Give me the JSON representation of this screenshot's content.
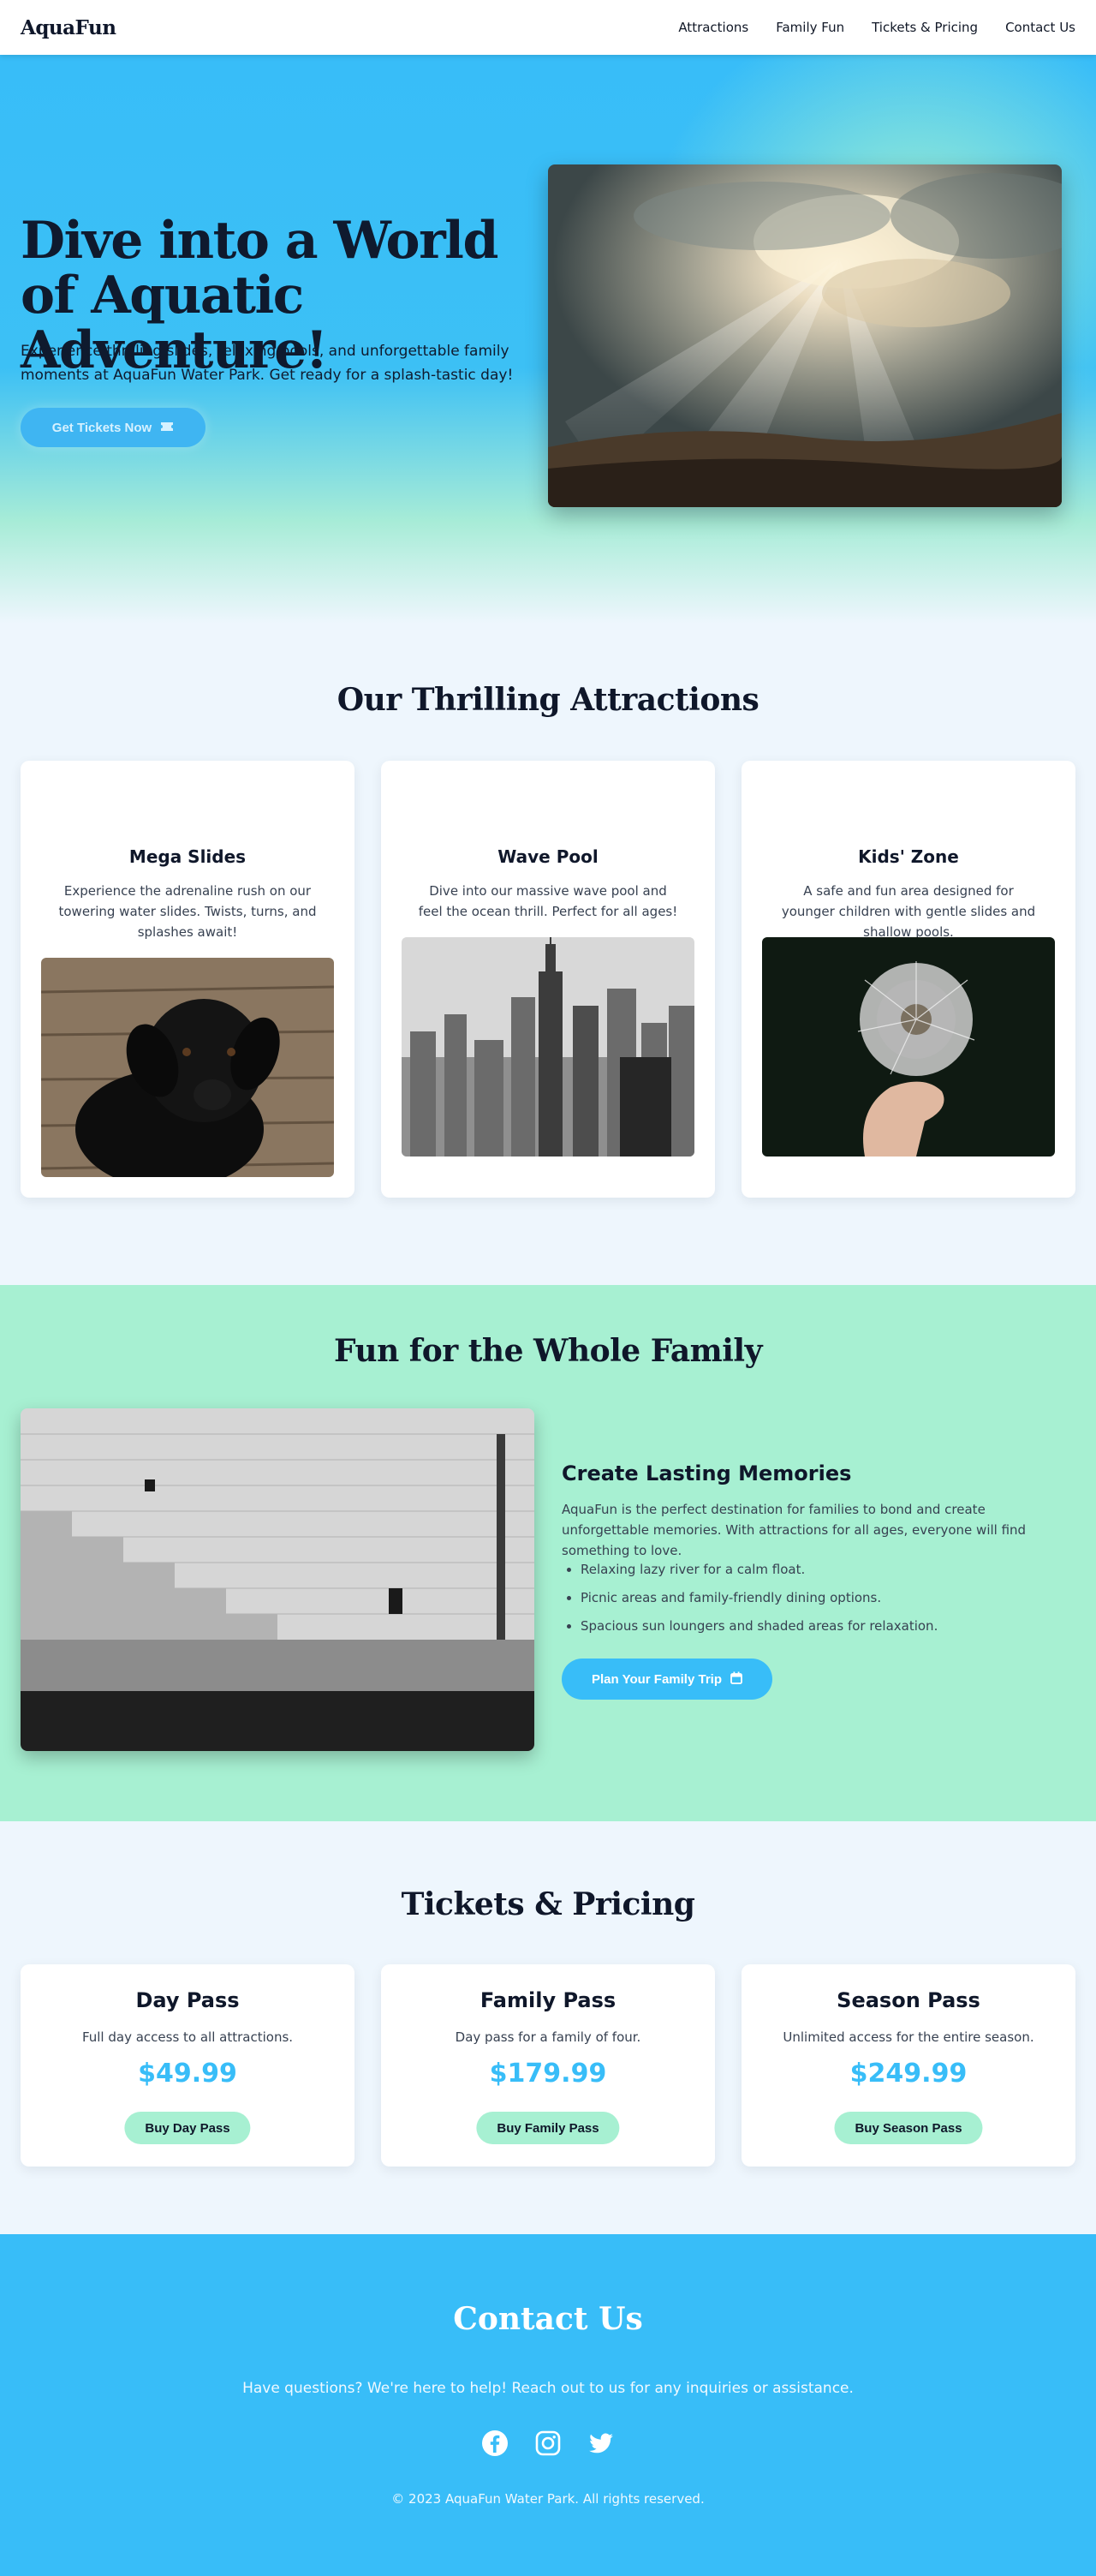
{
  "nav": {
    "logo": "AquaFun",
    "links": [
      "Attractions",
      "Family Fun",
      "Tickets & Pricing",
      "Contact Us"
    ]
  },
  "hero": {
    "title": "Dive into a World of Aquatic Adventure!",
    "text": "Experience thrilling slides, relaxing pools, and unforgettable family moments at AquaFun Water Park. Get ready for a splash-tastic day!",
    "cta": "Get Tickets Now",
    "cta_icon": "ticket-icon",
    "image": "sunrays-clouds-landscape-photo"
  },
  "attractions": {
    "title": "Our Thrilling Attractions",
    "cards": [
      {
        "title": "Mega Slides",
        "desc": "Experience the adrenaline rush on our towering water slides. Twists, turns, and splashes await!",
        "image": "black-puppy-photo"
      },
      {
        "title": "Wave Pool",
        "desc": "Dive into our massive wave pool and feel the ocean thrill. Perfect for all ages!",
        "image": "city-skyline-photo"
      },
      {
        "title": "Kids' Zone",
        "desc": "A safe and fun area designed for younger children with gentle slides and shallow pools.",
        "image": "dandelion-hand-photo"
      }
    ]
  },
  "family": {
    "title": "Fun for the Whole Family",
    "heading": "Create Lasting Memories",
    "text": "AquaFun is the perfect destination for families to bond and create unforgettable memories. With attractions for all ages, everyone will find something to love.",
    "list": [
      "Relaxing lazy river for a calm float.",
      "Picnic areas and family-friendly dining options.",
      "Spacious sun loungers and shaded areas for relaxation."
    ],
    "button": "Plan Your Family Trip",
    "button_icon": "calendar-icon",
    "image": "stone-steps-photo"
  },
  "tickets": {
    "title": "Tickets & Pricing",
    "cards": [
      {
        "name": "Day Pass",
        "desc": "Full day access to all attractions.",
        "price": "$49.99",
        "button": "Buy Day Pass"
      },
      {
        "name": "Family Pass",
        "desc": "Day pass for a family of four.",
        "price": "$179.99",
        "button": "Buy Family Pass"
      },
      {
        "name": "Season Pass",
        "desc": "Unlimited access for the entire season.",
        "price": "$249.99",
        "button": "Buy Season Pass"
      }
    ]
  },
  "contact": {
    "title": "Contact Us",
    "text": "Have questions? We're here to help! Reach out to us for any inquiries or assistance.",
    "socials": [
      "facebook-icon",
      "instagram-icon",
      "twitter-icon"
    ],
    "copyright": "© 2023 AquaFun Water Park. All rights reserved."
  },
  "colors": {
    "primary": "#38bdf8",
    "mint": "#a7f0d2",
    "background": "#eef6fd",
    "heading": "#0f172a"
  }
}
